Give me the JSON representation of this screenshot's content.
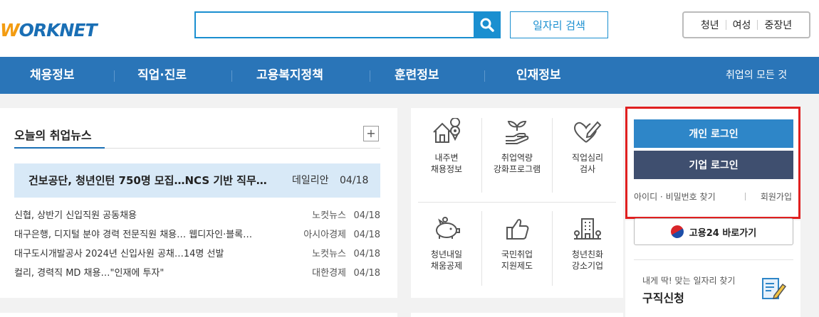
{
  "header": {
    "logo_text_accent": "W",
    "logo_text_main": "ORKNET",
    "search": {
      "value": "",
      "placeholder": ""
    },
    "job_search_label": "일자리 검색",
    "segments": [
      "청년",
      "여성",
      "중장년"
    ]
  },
  "nav": {
    "items": [
      "채용정보",
      "직업·진로",
      "고용복지정책",
      "훈련정보",
      "인재정보"
    ],
    "right_label": "취업의 모든 것"
  },
  "news": {
    "title": "오늘의 취업뉴스",
    "more_label": "+",
    "featured": {
      "title": "건보공단, 청년인턴 750명 모집…NCS 기반 직무…",
      "source": "데일리안",
      "date": "04/18"
    },
    "items": [
      {
        "title": "신협, 상반기 신입직원 공동채용",
        "source": "노컷뉴스",
        "date": "04/18"
      },
      {
        "title": "대구은행, 디지털 분야 경력 전문직원 채용… 웹디자인·블록…",
        "source": "아시아경제",
        "date": "04/18"
      },
      {
        "title": "대구도시개발공사 2024년 신입사원 공채…14명 선발",
        "source": "노컷뉴스",
        "date": "04/18"
      },
      {
        "title": "컬리, 경력직 MD 채용…\"인재에 투자\"",
        "source": "대한경제",
        "date": "04/18"
      }
    ]
  },
  "services": [
    {
      "icon": "house-location-icon",
      "line1": "내주변",
      "line2": "채용정보"
    },
    {
      "icon": "hand-sprout-icon",
      "line1": "취업역량",
      "line2": "강화프로그램"
    },
    {
      "icon": "heart-pen-icon",
      "line1": "직업심리",
      "line2": "검사"
    },
    {
      "icon": "piggy-bank-icon",
      "line1": "청년내일",
      "line2": "채움공제"
    },
    {
      "icon": "thumbs-up-icon",
      "line1": "국민취업",
      "line2": "지원제도"
    },
    {
      "icon": "building-tree-icon",
      "line1": "청년친화",
      "line2": "강소기업"
    }
  ],
  "login": {
    "personal_label": "개인 로그인",
    "corporate_label": "기업 로그인",
    "find_label": "아이디 · 비밀번호 찾기",
    "join_label": "회원가입"
  },
  "gov": {
    "label": "고용24 바로가기"
  },
  "job_apply": {
    "sub": "내게 딱! 맞는 일자리 찾기",
    "main": "구직신청"
  },
  "colors": {
    "brand_blue": "#2a75b8",
    "login_personal": "#2e86c8",
    "login_corporate": "#3f4f6f",
    "highlight_border": "#e02020"
  }
}
